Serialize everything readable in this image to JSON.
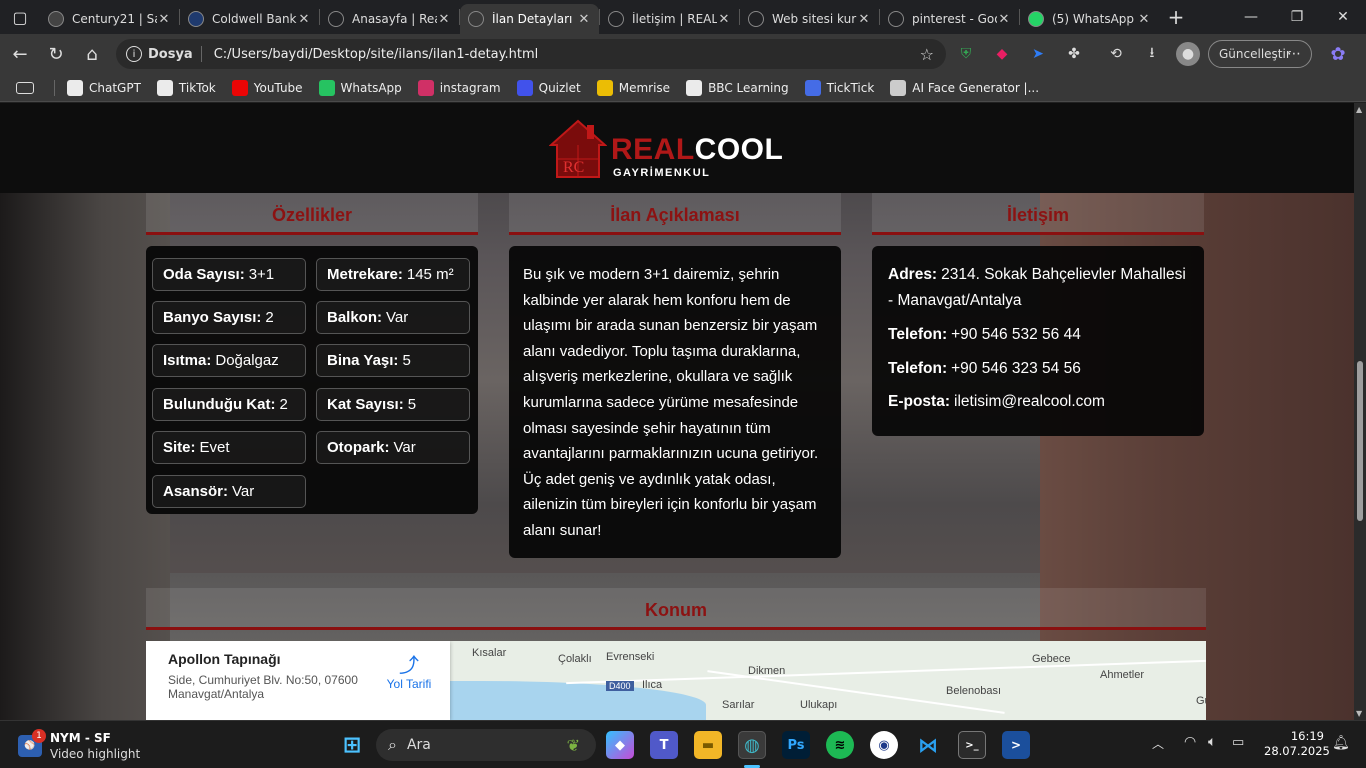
{
  "browser": {
    "tabs": [
      {
        "title": "Century21 | Sa",
        "icon": "century21-favicon",
        "color": "#444444",
        "active": false
      },
      {
        "title": "Coldwell Bank",
        "icon": "coldwell-favicon",
        "color": "#1f3a6e",
        "active": false
      },
      {
        "title": "Anasayfa | Rea",
        "icon": "globe-icon",
        "color": "#202124",
        "active": false
      },
      {
        "title": "İlan Detayları |",
        "icon": "globe-icon",
        "color": "#383838",
        "active": true
      },
      {
        "title": "İletişim | REALC",
        "icon": "globe-icon",
        "color": "#202124",
        "active": false
      },
      {
        "title": "Web sitesi kur",
        "icon": "openai-favicon",
        "color": "#202124",
        "active": false
      },
      {
        "title": "pinterest - Goo",
        "icon": "google-favicon",
        "color": "#202124",
        "active": false
      },
      {
        "title": "(5) WhatsApp",
        "icon": "whatsapp-favicon",
        "color": "#25d366",
        "active": false
      }
    ],
    "address_scheme": "Dosya",
    "address_url": "C:/Users/baydi/Desktop/site/ilans/ilan1-detay.html",
    "update_button": "Güncelleştir",
    "bookmarks": [
      {
        "label": "ChatGPT",
        "icon": "openai-icon",
        "color": "#ffffff"
      },
      {
        "label": "TikTok",
        "icon": "tiktok-icon",
        "color": "#ffffff"
      },
      {
        "label": "YouTube",
        "icon": "youtube-icon",
        "color": "#ff0000"
      },
      {
        "label": "WhatsApp",
        "icon": "whatsapp-icon",
        "color": "#25d366"
      },
      {
        "label": "instagram",
        "icon": "instagram-icon",
        "color": "#e1306c"
      },
      {
        "label": "Quizlet",
        "icon": "quizlet-icon",
        "color": "#4255ff"
      },
      {
        "label": "Memrise",
        "icon": "memrise-icon",
        "color": "#ffcc00"
      },
      {
        "label": "BBC Learning",
        "icon": "bbc-icon",
        "color": "#ffffff"
      },
      {
        "label": "TickTick",
        "icon": "ticktick-icon",
        "color": "#4772fa"
      },
      {
        "label": "AI Face Generator |...",
        "icon": "globe-icon",
        "color": "#dddddd"
      }
    ]
  },
  "page": {
    "logo": {
      "brand_red": "REAL",
      "brand_white": "COOL",
      "subtitle": "GAYRİMENKUL",
      "monogram": "RC"
    },
    "features": {
      "heading": "Özellikler",
      "items": [
        {
          "label": "Oda Sayısı:",
          "value": "3+1"
        },
        {
          "label": "Metrekare:",
          "value": "145 m²"
        },
        {
          "label": "Banyo Sayısı:",
          "value": "2"
        },
        {
          "label": "Balkon:",
          "value": "Var"
        },
        {
          "label": "Isıtma:",
          "value": "Doğalgaz"
        },
        {
          "label": "Bina Yaşı:",
          "value": "5"
        },
        {
          "label": "Bulunduğu Kat:",
          "value": "2"
        },
        {
          "label": "Kat Sayısı:",
          "value": "5"
        },
        {
          "label": "Site:",
          "value": "Evet"
        },
        {
          "label": "Otopark:",
          "value": "Var"
        },
        {
          "label": "Asansör:",
          "value": "Var"
        }
      ]
    },
    "description": {
      "heading": "İlan Açıklaması",
      "text": "Bu şık ve modern 3+1 dairemiz, şehrin kalbinde yer alarak hem konforu hem de ulaşımı bir arada sunan benzersiz bir yaşam alanı vadediyor. Toplu taşıma duraklarına, alışveriş merkezlerine, okullara ve sağlık kurumlarına sadece yürüme mesafesinde olması sayesinde şehir hayatının tüm avantajlarını parmaklarınızın ucuna getiriyor. Üç adet geniş ve aydınlık yatak odası, ailenizin tüm bireyleri için konforlu bir yaşam alanı sunar!"
    },
    "contact": {
      "heading": "İletişim",
      "address_label": "Adres:",
      "address_value": "2314. Sokak Bahçelievler Mahallesi - Manavgat/Antalya",
      "phone1_label": "Telefon:",
      "phone1_value": "+90 546 532 56 44",
      "phone2_label": "Telefon:",
      "phone2_value": "+90 546 323 54 56",
      "email_label": "E-posta:",
      "email_value": "iletisim@realcool.com"
    },
    "location": {
      "heading": "Konum",
      "place_title": "Apollon Tapınağı",
      "place_address": "Side, Cumhuriyet Blv. No:50, 07600 Manavgat/Antalya",
      "directions": "Yol Tarifi",
      "map_labels": [
        "Kısalar",
        "Çolaklı",
        "Evrenseki",
        "D400",
        "Ilıca",
        "Dikmen",
        "Sarılar",
        "Ulukapı",
        "Gebece",
        "Belenobası",
        "Ahmetler",
        "Güçl"
      ]
    },
    "accent_color": "#8c1212"
  },
  "taskbar": {
    "widget_title": "NYM - SF",
    "widget_sub": "Video highlight",
    "widget_badge": "1",
    "search_placeholder": "Ara",
    "time": "16:19",
    "date": "28.07.2025"
  }
}
